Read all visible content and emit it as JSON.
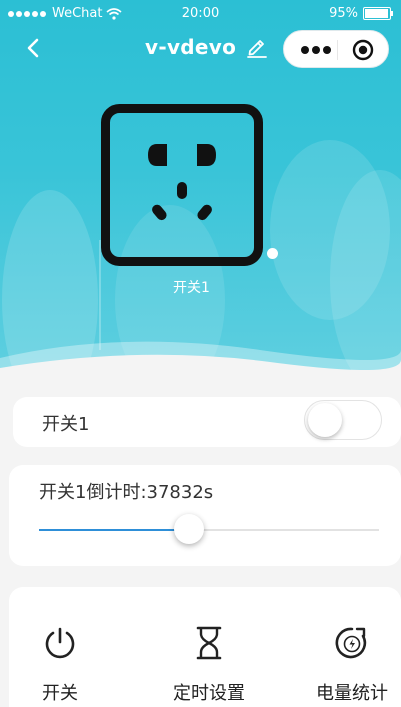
{
  "status_bar": {
    "carrier": "WeChat",
    "time": "20:00",
    "battery": "95%",
    "battery_level": 0.95
  },
  "nav": {
    "title": "v-vdevo"
  },
  "device": {
    "socket_label": "开关1"
  },
  "switch_row": {
    "label": "开关1",
    "on": false
  },
  "countdown": {
    "label": "开关1倒计时:37832s",
    "slider_fraction": 0.44
  },
  "functions": [
    {
      "label": "开关",
      "icon": "power-icon"
    },
    {
      "label": "定时设置",
      "icon": "hourglass-icon"
    },
    {
      "label": "电量统计",
      "icon": "energy-stat-icon"
    }
  ],
  "colors": {
    "header_bg": "#2bbfd4",
    "accent": "#2e8fd8",
    "page_bg": "#f4f4f4"
  }
}
